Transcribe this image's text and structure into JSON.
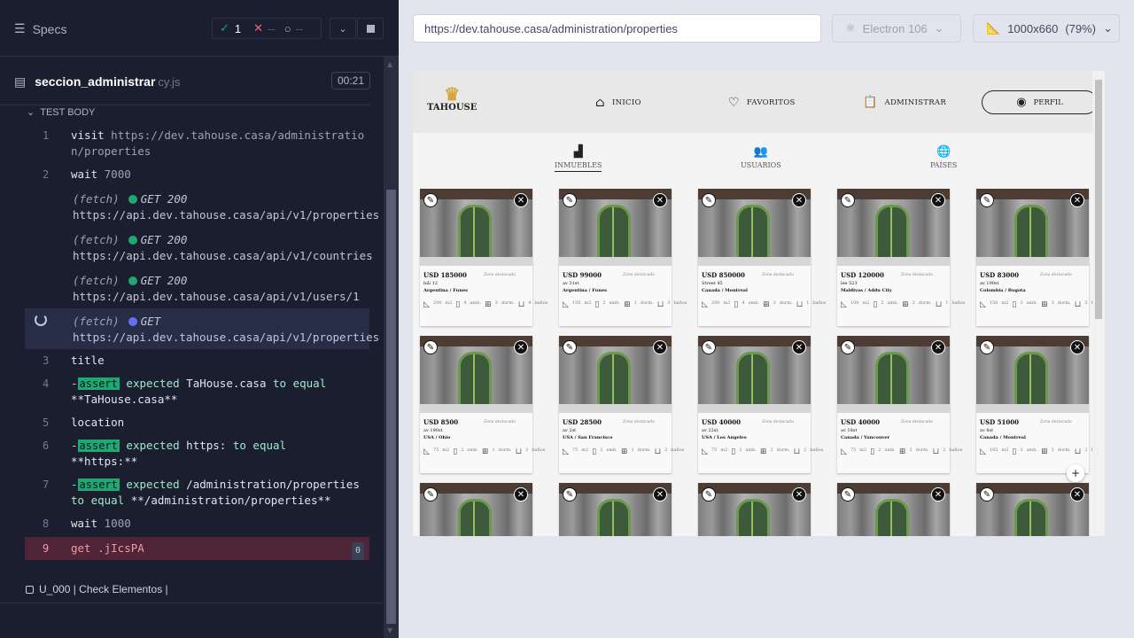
{
  "runner": {
    "specs_label": "Specs",
    "passed_count": "1",
    "failed_count": "--",
    "pending_count": "--",
    "spec_name": "seccion_administrar",
    "spec_ext": "cy.js",
    "timer": "00:21",
    "test_body_label": "TEST BODY",
    "next_test": "U_000 | Check Elementos |",
    "commands": [
      {
        "type": "cmd",
        "num": "1",
        "name": "visit",
        "arg": "https://dev.tahouse.casa/administration/properties"
      },
      {
        "type": "cmd",
        "num": "2",
        "name": "wait",
        "arg": "7000"
      },
      {
        "type": "fetch",
        "label": "(fetch)",
        "method": "GET 200",
        "url": "https://api.dev.tahouse.casa/api/v1/properties",
        "status": "ok"
      },
      {
        "type": "fetch",
        "label": "(fetch)",
        "method": "GET 200",
        "url": "https://api.dev.tahouse.casa/api/v1/countries",
        "status": "ok"
      },
      {
        "type": "fetch",
        "label": "(fetch)",
        "method": "GET 200",
        "url": "https://api.dev.tahouse.casa/api/v1/users/1",
        "status": "ok"
      },
      {
        "type": "fetch",
        "label": "(fetch)",
        "method": "GET",
        "url": "https://api.dev.tahouse.casa/api/v1/properties",
        "status": "pending"
      },
      {
        "type": "cmd",
        "num": "3",
        "name": "title",
        "arg": ""
      },
      {
        "type": "assert",
        "num": "4",
        "badge": "assert",
        "text1": "expected",
        "val1": "TaHouse.casa",
        "text2": "to equal",
        "val2": "**TaHouse.casa**"
      },
      {
        "type": "cmd",
        "num": "5",
        "name": "location",
        "arg": ""
      },
      {
        "type": "assert",
        "num": "6",
        "badge": "assert",
        "text1": "expected",
        "val1": "https:",
        "text2": "to equal",
        "val2": "**https:**"
      },
      {
        "type": "assert",
        "num": "7",
        "badge": "assert",
        "text1": "expected",
        "val1": "/administration/properties",
        "text2": "to equal",
        "val2": "**/administration/properties**"
      },
      {
        "type": "cmd",
        "num": "8",
        "name": "wait",
        "arg": "1000"
      },
      {
        "type": "failed",
        "num": "9",
        "name": "get",
        "arg": ".jIcsPA",
        "count": "0"
      }
    ]
  },
  "browser": {
    "url": "https://dev.tahouse.casa/administration/properties",
    "browser_name": "Electron 106",
    "viewport": "1000x660",
    "zoom": "(79%)"
  },
  "app": {
    "logo_text": "TAHOUSE",
    "nav": [
      "INICIO",
      "FAVORITOS",
      "ADMINISTRAR",
      "PERFIL"
    ],
    "subnav": [
      "INMUEBLES",
      "USUARIOS",
      "PAÍSES"
    ],
    "featured_label": "Zona destacada",
    "cards": [
      {
        "price": "USD 185000",
        "street": "hili 12",
        "location": "Argentina / Funes",
        "m2": "200",
        "amb": "4",
        "dorm": "3",
        "banos": "4"
      },
      {
        "price": "USD 99000",
        "street": "av 31st",
        "location": "Argentina / Funes",
        "m2": "150",
        "amb": "2",
        "dorm": "1",
        "banos": "3"
      },
      {
        "price": "USD 850000",
        "street": "Street 45",
        "location": "Canada / Montreal",
        "m2": "200",
        "amb": "4",
        "dorm": "3",
        "banos": "1"
      },
      {
        "price": "USD 120000",
        "street": "lee 523",
        "location": "Maldivas / Addu City",
        "m2": "100",
        "amb": "2",
        "dorm": "2",
        "banos": "1"
      },
      {
        "price": "USD 83000",
        "street": "av 190st",
        "location": "Colombia / Bogota",
        "m2": "150",
        "amb": "3",
        "dorm": "3",
        "banos": "3"
      },
      {
        "price": "USD 8500",
        "street": "av 190st",
        "location": "USA / Ohio",
        "m2": "75",
        "amb": "2",
        "dorm": "1",
        "banos": "2"
      },
      {
        "price": "USD 28500",
        "street": "av 2st",
        "location": "USA / San Francisco",
        "m2": "75",
        "amb": "2",
        "dorm": "1",
        "banos": "2"
      },
      {
        "price": "USD 40000",
        "street": "av 22st",
        "location": "USA / Los Angeles",
        "m2": "75",
        "amb": "2",
        "dorm": "2",
        "banos": "2"
      },
      {
        "price": "USD 40000",
        "street": "av 18st",
        "location": "Canada / Vancouver",
        "m2": "75",
        "amb": "2",
        "dorm": "2",
        "banos": "2"
      },
      {
        "price": "USD 51000",
        "street": "av 8st",
        "location": "Canada / Montreal",
        "m2": "105",
        "amb": "3",
        "dorm": "2",
        "banos": "2"
      }
    ]
  }
}
